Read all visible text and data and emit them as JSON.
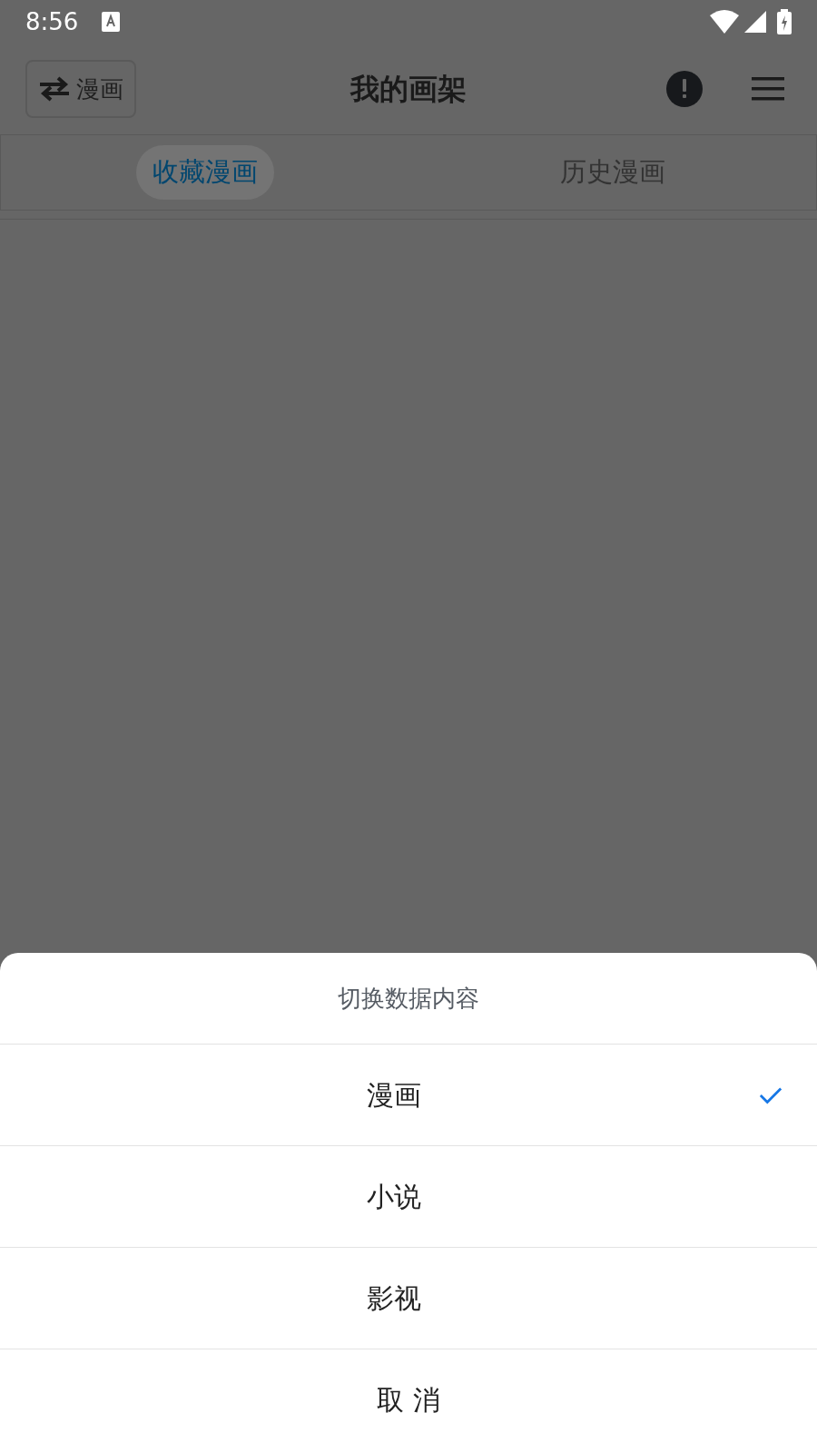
{
  "status_bar": {
    "time": "8:56"
  },
  "app_bar": {
    "switch_button": "漫画",
    "title": "我的画架"
  },
  "tabs": [
    {
      "label": "收藏漫画",
      "selected": true
    },
    {
      "label": "历史漫画",
      "selected": false
    }
  ],
  "sheet": {
    "title": "切换数据内容",
    "options": [
      {
        "label": "漫画",
        "selected": true
      },
      {
        "label": "小说",
        "selected": false
      },
      {
        "label": "影视",
        "selected": false
      }
    ],
    "cancel": "取 消"
  }
}
